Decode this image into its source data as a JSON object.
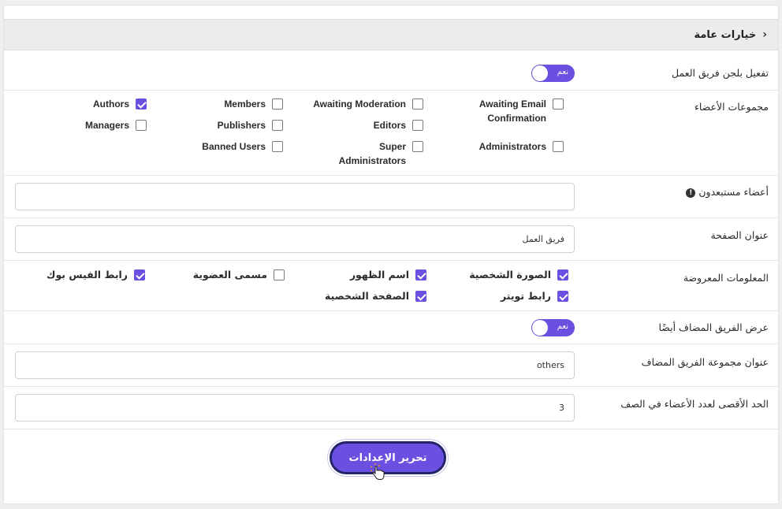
{
  "header": {
    "title": "خيارات عامة"
  },
  "rows": {
    "activate_plugin": {
      "label": "تفعيل بلجن فريق العمل",
      "toggle_text": "نعم",
      "on": true
    },
    "member_groups": {
      "label": "مجموعات الأعضاء",
      "items": [
        {
          "name": "Awaiting Email Confirmation",
          "checked": false
        },
        {
          "name": "Awaiting Moderation",
          "checked": false
        },
        {
          "name": "Members",
          "checked": false
        },
        {
          "name": "Authors",
          "checked": true
        },
        {
          "name": "Editors",
          "checked": false
        },
        {
          "name": "Publishers",
          "checked": false
        },
        {
          "name": "Managers",
          "checked": false
        },
        {
          "name": "Administrators",
          "checked": false
        },
        {
          "name": "Super Administrators",
          "checked": false
        },
        {
          "name": "Banned Users",
          "checked": false
        }
      ]
    },
    "excluded_members": {
      "label": "أعضاء مستبعدون",
      "value": ""
    },
    "page_title": {
      "label": "عنوان الصفحة",
      "value": "فريق العمل"
    },
    "displayed_info": {
      "label": "المعلومات المعروضة",
      "items": [
        {
          "name": "الصورة الشخصية",
          "checked": true
        },
        {
          "name": "اسم الظهور",
          "checked": true
        },
        {
          "name": "مسمى العضوية",
          "checked": false
        },
        {
          "name": "رابط الفيس بوك",
          "checked": true
        },
        {
          "name": "رابط تويتر",
          "checked": true
        },
        {
          "name": "الصفحة الشخصية",
          "checked": true
        }
      ]
    },
    "show_added_team": {
      "label": "عرض الفريق المضاف أيضًا",
      "toggle_text": "نعم",
      "on": true
    },
    "added_group_title": {
      "label": "عنوان مجموعة الفريق المضاف",
      "value": "others"
    },
    "max_members_per_row": {
      "label": "الحد الأقصى لعدد الأعضاء في الصف",
      "value": "3"
    }
  },
  "actions": {
    "save_label": "تحرير الإعدادات"
  },
  "colors": {
    "accent": "#6b4fe0",
    "button_border": "#24246b"
  }
}
